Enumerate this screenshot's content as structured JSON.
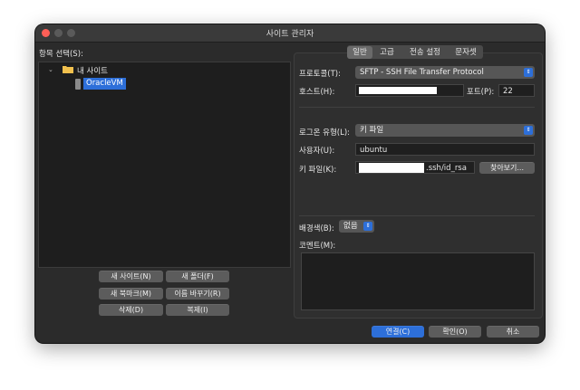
{
  "window": {
    "title": "사이트 관리자"
  },
  "left": {
    "select_label": "항목 선택(S):",
    "tree": {
      "root_label": "내 사이트",
      "site_label": "OracleVM"
    },
    "buttons": {
      "new_site": "새 사이트(N)",
      "new_folder": "새 폴더(F)",
      "new_bookmark": "새 북마크(M)",
      "rename": "이름 바꾸기(R)",
      "delete": "삭제(D)",
      "duplicate": "복제(I)"
    }
  },
  "tabs": [
    "일반",
    "고급",
    "전송 설정",
    "문자셋"
  ],
  "general": {
    "protocol_label": "프로토콜(T):",
    "protocol_value": "SFTP - SSH File Transfer Protocol",
    "host_label": "호스트(H):",
    "host_value": "",
    "port_label": "포트(P):",
    "port_value": "22",
    "logon_label": "로그온 유형(L):",
    "logon_value": "키 파일",
    "user_label": "사용자(U):",
    "user_value": "ubuntu",
    "keyfile_label": "키 파일(K):",
    "keyfile_value": ".ssh/id_rsa",
    "browse_button": "찾아보기...",
    "bgcolor_label": "배경색(B):",
    "bgcolor_value": "없음",
    "comment_label": "코멘트(M):"
  },
  "footer": {
    "connect": "연결(C)",
    "ok": "확인(O)",
    "cancel": "취소"
  },
  "colors": {
    "accent": "#2d6fd9",
    "window_bg": "#2b2b2b",
    "close": "#ff5f57",
    "minimize": "#febc2e",
    "zoom": "#28c840"
  }
}
